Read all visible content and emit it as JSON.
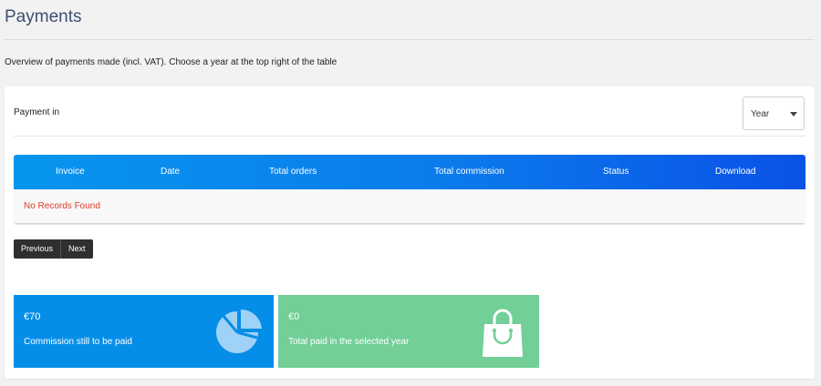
{
  "header": {
    "title": "Payments",
    "intro": "Overview of payments made (incl. VAT). Choose a year at the top right of the table"
  },
  "filter": {
    "label": "Payment in",
    "year_select": "Year"
  },
  "table": {
    "columns": [
      "Invoice",
      "Date",
      "Total orders",
      "Total commission",
      "Status",
      "Download"
    ],
    "empty_message": "No Records Found"
  },
  "pagination": {
    "previous": "Previous",
    "next": "Next"
  },
  "stats": [
    {
      "amount": "€70",
      "label": "Commission still to be paid",
      "icon": "pie-chart-icon",
      "color": "#058ee8"
    },
    {
      "amount": "€0",
      "label": "Total paid in the selected year",
      "icon": "shopping-bag-icon",
      "color": "#71cf97"
    }
  ]
}
